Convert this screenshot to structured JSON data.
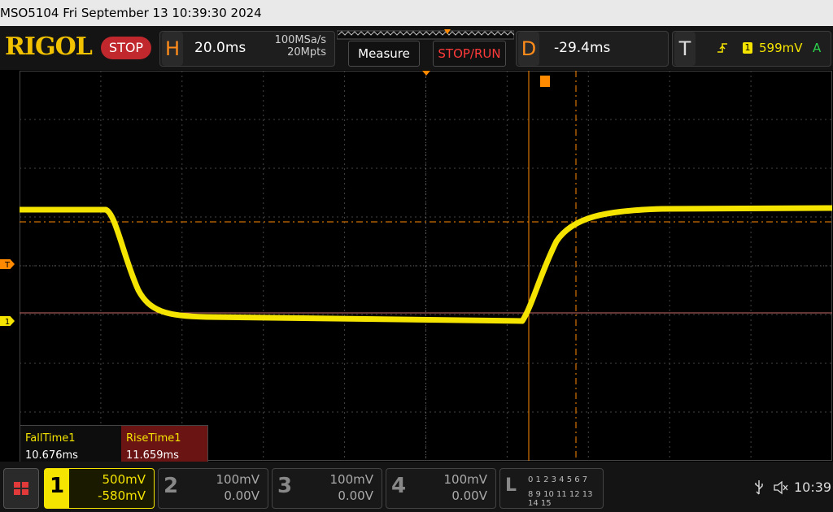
{
  "title_bar": {
    "text": "MSO5104  Fri September 13 10:39:30 2024"
  },
  "header": {
    "brand": "RIGOL",
    "run_state": "STOP",
    "horizontal": {
      "letter": "H",
      "timebase": "20.0ms",
      "sample_rate": "100MSa/s",
      "memory_depth": "20Mpts"
    },
    "delay": {
      "letter": "D",
      "value": "-29.4ms"
    },
    "trigger": {
      "letter": "T",
      "channel": "1",
      "level": "599mV",
      "mode": "A"
    },
    "buttons": {
      "measure": "Measure",
      "stop_run": "STOP/RUN"
    }
  },
  "markers": {
    "trigger_level": "T",
    "channel1_ground": "1"
  },
  "measurements": [
    {
      "label": "FallTime1",
      "value": "10.676ms"
    },
    {
      "label": "RiseTime1",
      "value": "11.659ms"
    }
  ],
  "channels": [
    {
      "num": "1",
      "scale": "500mV",
      "offset": "-580mV",
      "active": true
    },
    {
      "num": "2",
      "scale": "100mV",
      "offset": "0.00V",
      "active": false
    },
    {
      "num": "3",
      "scale": "100mV",
      "offset": "0.00V",
      "active": false
    },
    {
      "num": "4",
      "scale": "100mV",
      "offset": "0.00V",
      "active": false
    }
  ],
  "logic": {
    "letter": "L",
    "row1": "0 1 2 3   4 5 6 7",
    "row2": "8 9 10 11 12 13 14 15"
  },
  "status": {
    "time": "10:39"
  },
  "colors": {
    "channel1": "#f5e400",
    "trigger": "#ff8a00",
    "accent_orange": "#ff8c1a",
    "stop_red": "#c0282d"
  },
  "icons": [
    "menu-icon",
    "usb-icon",
    "speaker-muted-icon"
  ]
}
